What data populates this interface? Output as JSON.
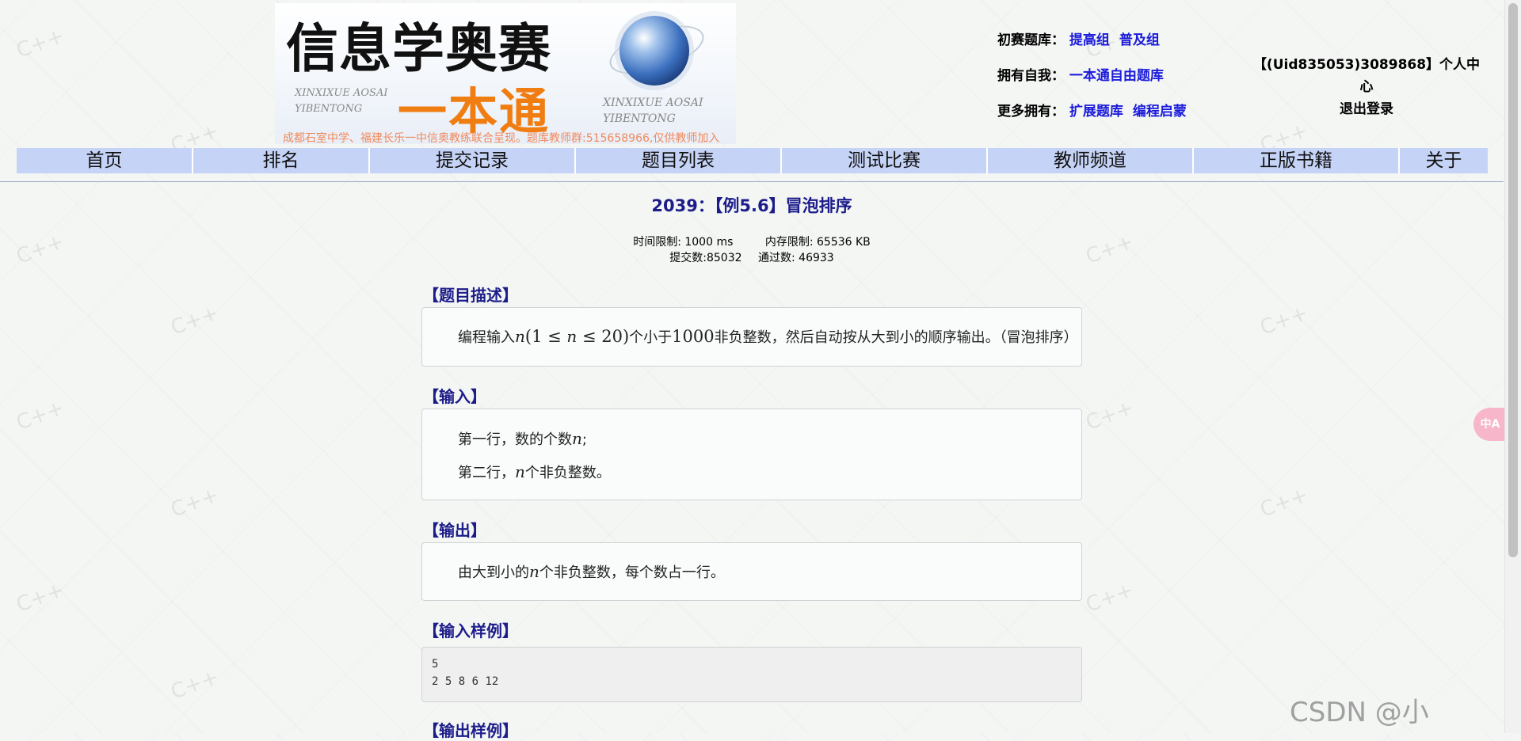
{
  "header": {
    "banner": {
      "title": "信息学奥赛",
      "subtitle": "一本通",
      "en_left": "XINXIXUE AOSAI YIBENTONG",
      "en_right": "XINXIXUE AOSAI YIBENTONG",
      "note": "成都石室中学、福建长乐一中信奥教练联合呈现。题库教师群:515658966,仅供教师加入"
    },
    "links": [
      {
        "label": "初赛题库：",
        "items": [
          "提高组",
          "普及组"
        ]
      },
      {
        "label": "拥有自我：",
        "items": [
          "一本通自由题库"
        ]
      },
      {
        "label": "更多拥有：",
        "items": [
          "扩展题库",
          "编程启蒙"
        ]
      }
    ],
    "user": {
      "center": "【(Uid835053)3089868】个人中心",
      "logout": "退出登录"
    }
  },
  "nav": {
    "items": [
      "首页",
      "排名",
      "提交记录",
      "题目列表",
      "测试比赛",
      "教师频道",
      "正版书籍",
      "关于"
    ]
  },
  "problem": {
    "title": "2039：【例5.6】冒泡排序",
    "time_limit": "时间限制: 1000 ms",
    "memory_limit": "内存限制: 65536 KB",
    "submissions": "提交数:85032",
    "accepted": "通过数: 46933",
    "sections": {
      "description": {
        "heading": "【题目描述】",
        "parts": {
          "pre": "编程输入",
          "var": "n",
          "open": "(1 ≤ ",
          "var2": "n",
          "close": " ≤ 20)",
          "mid": "个小于",
          "num": "1000",
          "post": "非负整数，然后自动按从大到小的顺序输出。（冒泡排序）"
        }
      },
      "input": {
        "heading": "【输入】",
        "line1_pre": "第一行，数的个数",
        "line1_var": "n",
        "line1_post": ";",
        "line2_pre": "第二行，",
        "line2_var": "n",
        "line2_post": "个非负整数。"
      },
      "output": {
        "heading": "【输出】",
        "pre": "由大到小的",
        "var": "n",
        "post": "个非负整数，每个数占一行。"
      },
      "sample_input": {
        "heading": "【输入样例】",
        "lines": [
          "5",
          "2 5 8 6 12"
        ]
      },
      "sample_output": {
        "heading": "【输出样例】"
      }
    }
  },
  "watermarks": {
    "csdn": "CSDN @小"
  },
  "widgets": {
    "translate": "中A"
  }
}
